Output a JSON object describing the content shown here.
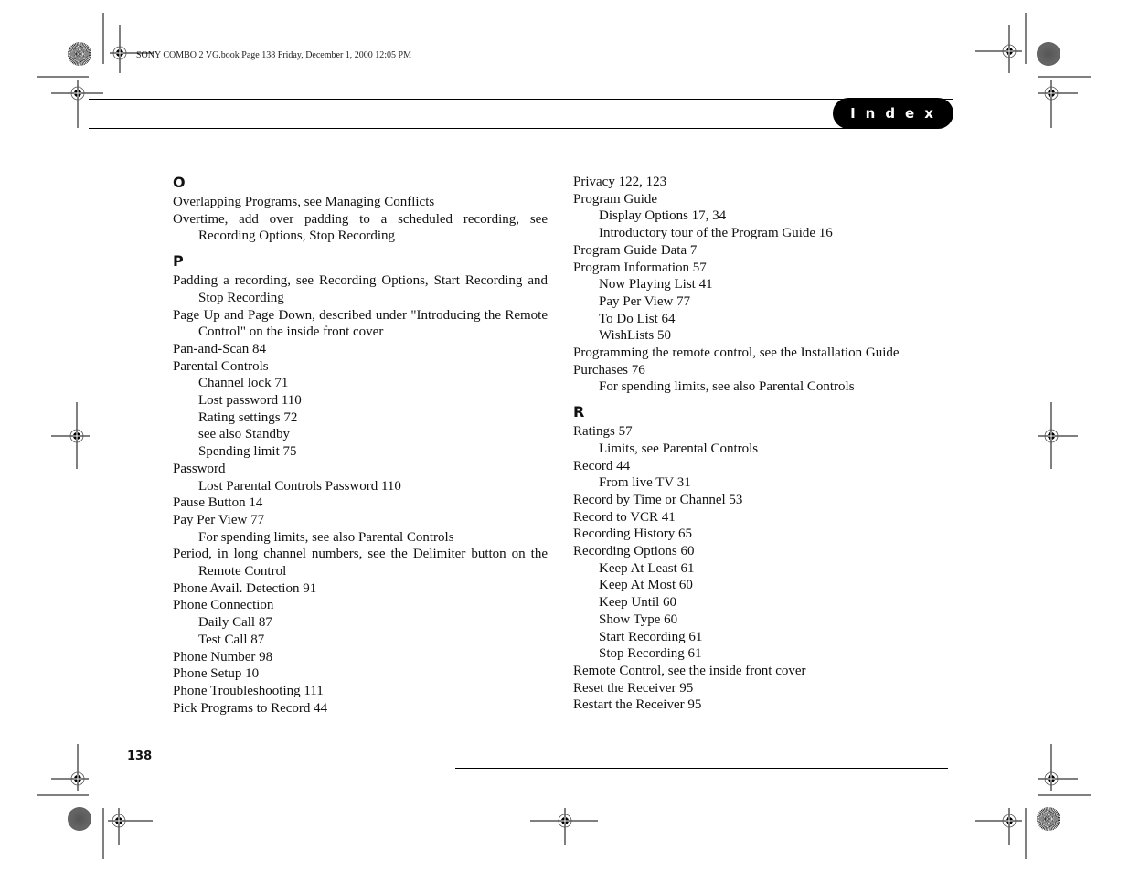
{
  "header": {
    "slug": "SONY COMBO 2 VG.book  Page 138  Friday, December 1, 2000  12:05 PM",
    "section_tab": "Index"
  },
  "footer": {
    "page_number": "138"
  },
  "left_column": {
    "sections": [
      {
        "letter": "O",
        "entries": [
          {
            "text": "Overlapping Programs, see Managing Conflicts",
            "subs": []
          },
          {
            "text": "Overtime, add over padding to a scheduled recording, see Recording Options, Stop Recording",
            "subs": []
          }
        ]
      },
      {
        "letter": "P",
        "entries": [
          {
            "text": "Padding a recording, see Recording Options, Start Recording and Stop Recording",
            "subs": []
          },
          {
            "text": "Page Up and Page Down, described under \"Introducing the Remote Control\" on the inside front cover",
            "subs": []
          },
          {
            "text": "Pan-and-Scan 84",
            "subs": []
          },
          {
            "text": "Parental Controls",
            "subs": [
              "Channel lock 71",
              "Lost password 110",
              "Rating settings 72",
              "see also Standby",
              "Spending limit 75"
            ]
          },
          {
            "text": "Password",
            "subs": [
              "Lost Parental Controls Password 110"
            ]
          },
          {
            "text": "Pause Button 14",
            "subs": []
          },
          {
            "text": "Pay Per View 77",
            "subs": [
              "For spending limits, see also Parental Controls"
            ]
          },
          {
            "text": "Period, in long channel numbers, see the Delimiter button on the Remote Control",
            "subs": []
          },
          {
            "text": "Phone Avail. Detection 91",
            "subs": []
          },
          {
            "text": "Phone Connection",
            "subs": [
              "Daily Call 87",
              "Test Call 87"
            ]
          },
          {
            "text": "Phone Number 98",
            "subs": []
          },
          {
            "text": "Phone Setup 10",
            "subs": []
          },
          {
            "text": "Phone Troubleshooting 111",
            "subs": []
          },
          {
            "text": "Pick Programs to Record 44",
            "subs": []
          }
        ]
      }
    ]
  },
  "right_column": {
    "sections": [
      {
        "letter": "",
        "entries": [
          {
            "text": "Privacy 122, 123",
            "subs": []
          },
          {
            "text": "Program Guide",
            "subs": [
              "Display Options 17, 34",
              "Introductory tour of the Program Guide 16"
            ]
          },
          {
            "text": "Program Guide Data 7",
            "subs": []
          },
          {
            "text": "Program Information 57",
            "subs": [
              "Now Playing List 41",
              "Pay Per View 77",
              "To Do List 64",
              "WishLists 50"
            ]
          },
          {
            "text": "Programming the remote control, see the Installation Guide",
            "subs": []
          },
          {
            "text": "Purchases 76",
            "subs": [
              "For spending limits, see also Parental Controls"
            ]
          }
        ]
      },
      {
        "letter": "R",
        "entries": [
          {
            "text": "Ratings 57",
            "subs": [
              "Limits, see Parental Controls"
            ]
          },
          {
            "text": "Record 44",
            "subs": [
              "From live TV 31"
            ]
          },
          {
            "text": "Record by Time or Channel 53",
            "subs": []
          },
          {
            "text": "Record to VCR 41",
            "subs": []
          },
          {
            "text": "Recording History 65",
            "subs": []
          },
          {
            "text": "Recording Options 60",
            "subs": [
              "Keep At Least 61",
              "Keep At Most 60",
              "Keep Until 60",
              "Show Type 60",
              "Start Recording 61",
              "Stop Recording 61"
            ]
          },
          {
            "text": "Remote Control, see the inside front cover",
            "subs": []
          },
          {
            "text": "Reset the Receiver 95",
            "subs": []
          },
          {
            "text": "Restart the Receiver 95",
            "subs": []
          }
        ]
      }
    ]
  }
}
